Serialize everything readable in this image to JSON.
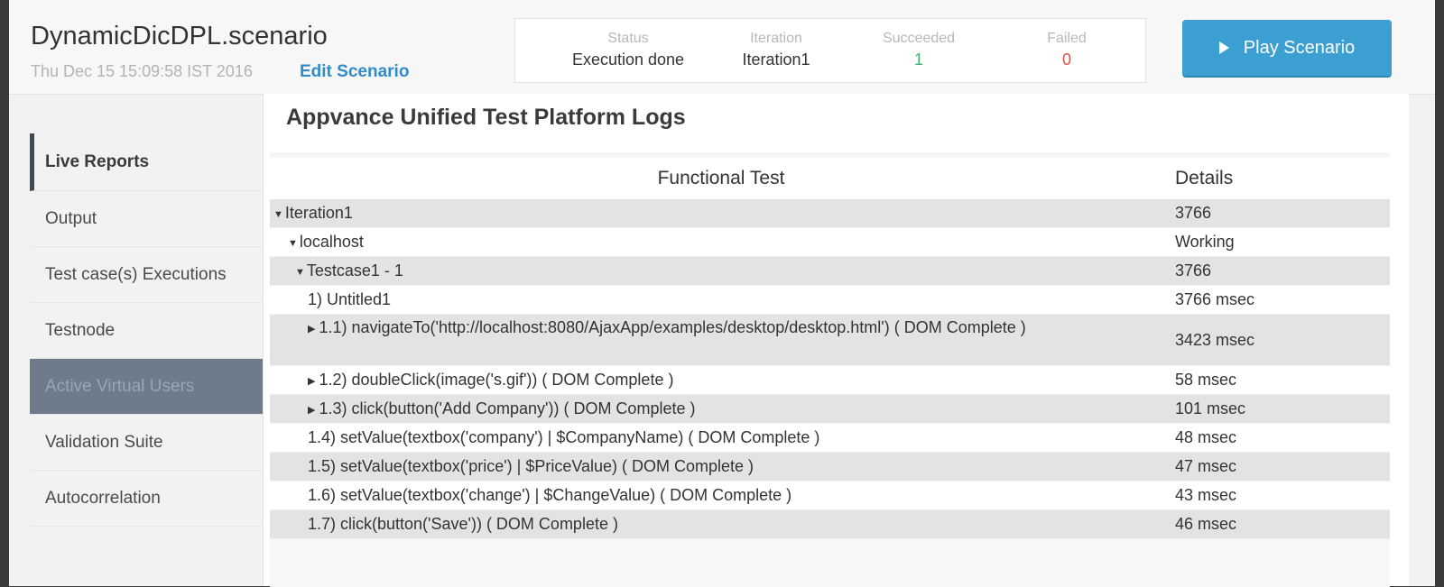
{
  "header": {
    "title": "DynamicDicDPL.scenario",
    "date": "Thu Dec 15 15:09:58 IST 2016",
    "edit_label": "Edit Scenario",
    "play_label": "Play Scenario"
  },
  "stats": {
    "status_label": "Status",
    "status_value": "Execution done",
    "iteration_label": "Iteration",
    "iteration_value": "Iteration1",
    "succeeded_label": "Succeeded",
    "succeeded_value": "1",
    "failed_label": "Failed",
    "failed_value": "0"
  },
  "colors": {
    "succeeded": "#3cb371",
    "failed": "#e0504a",
    "accent": "#3b9fd1"
  },
  "sidebar": {
    "items": [
      {
        "label": "Live Reports"
      },
      {
        "label": "Output"
      },
      {
        "label": "Test case(s) Executions"
      },
      {
        "label": "Testnode"
      },
      {
        "label": "Active Virtual Users"
      },
      {
        "label": "Validation Suite"
      },
      {
        "label": "Autocorrelation"
      }
    ]
  },
  "main": {
    "title": "Appvance Unified Test Platform Logs",
    "col_test": "Functional Test",
    "col_details": "Details",
    "rows": [
      {
        "text": "Iteration1",
        "details": "3766"
      },
      {
        "text": "localhost",
        "details": "Working"
      },
      {
        "text": "Testcase1 - 1",
        "details": "3766"
      },
      {
        "text": "1) Untitled1",
        "details": "3766 msec"
      },
      {
        "text": "1.1) navigateTo('http://localhost:8080/AjaxApp/examples/desktop/desktop.html') ( DOM Complete )",
        "details": "3423 msec"
      },
      {
        "text": "1.2) doubleClick(image('s.gif')) ( DOM Complete )",
        "details": "58 msec"
      },
      {
        "text": "1.3) click(button('Add Company')) ( DOM Complete )",
        "details": "101 msec"
      },
      {
        "text": "1.4) setValue(textbox('company') | $CompanyName) ( DOM Complete )",
        "details": "48 msec"
      },
      {
        "text": "1.5) setValue(textbox('price') | $PriceValue) ( DOM Complete )",
        "details": "47 msec"
      },
      {
        "text": "1.6) setValue(textbox('change') | $ChangeValue) ( DOM Complete )",
        "details": "43 msec"
      },
      {
        "text": "1.7) click(button('Save')) ( DOM Complete )",
        "details": "46 msec"
      }
    ]
  }
}
